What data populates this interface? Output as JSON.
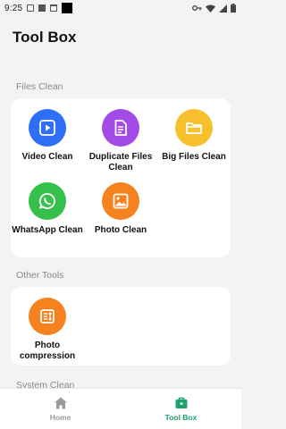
{
  "status_bar": {
    "time": "9:25"
  },
  "page": {
    "title": "Tool Box"
  },
  "sections": {
    "files": {
      "label": "Files Clean",
      "tools": [
        {
          "label": "Video Clean",
          "icon": "play-video-icon",
          "color": "#2f6ff5"
        },
        {
          "label": "Duplicate Files Clean",
          "icon": "document-icon",
          "color": "#a24be6"
        },
        {
          "label": "Big Files Clean",
          "icon": "folder-icon",
          "color": "#f7c12e"
        },
        {
          "label": "WhatsApp Clean",
          "icon": "whatsapp-icon",
          "color": "#35c04b"
        },
        {
          "label": "Photo Clean",
          "icon": "image-icon",
          "color": "#f6821f"
        }
      ]
    },
    "other": {
      "label": "Other Tools",
      "tools": [
        {
          "label": "Photo compression",
          "icon": "compress-icon",
          "color": "#f6821f"
        }
      ]
    },
    "system": {
      "label": "System Clean"
    }
  },
  "bottom_nav": {
    "items": [
      {
        "label": "Home",
        "icon": "home-icon",
        "active": false
      },
      {
        "label": "Tool Box",
        "icon": "toolbox-icon",
        "active": true
      }
    ],
    "active_color": "#1aa36b",
    "inactive_color": "#9a9a9a"
  }
}
